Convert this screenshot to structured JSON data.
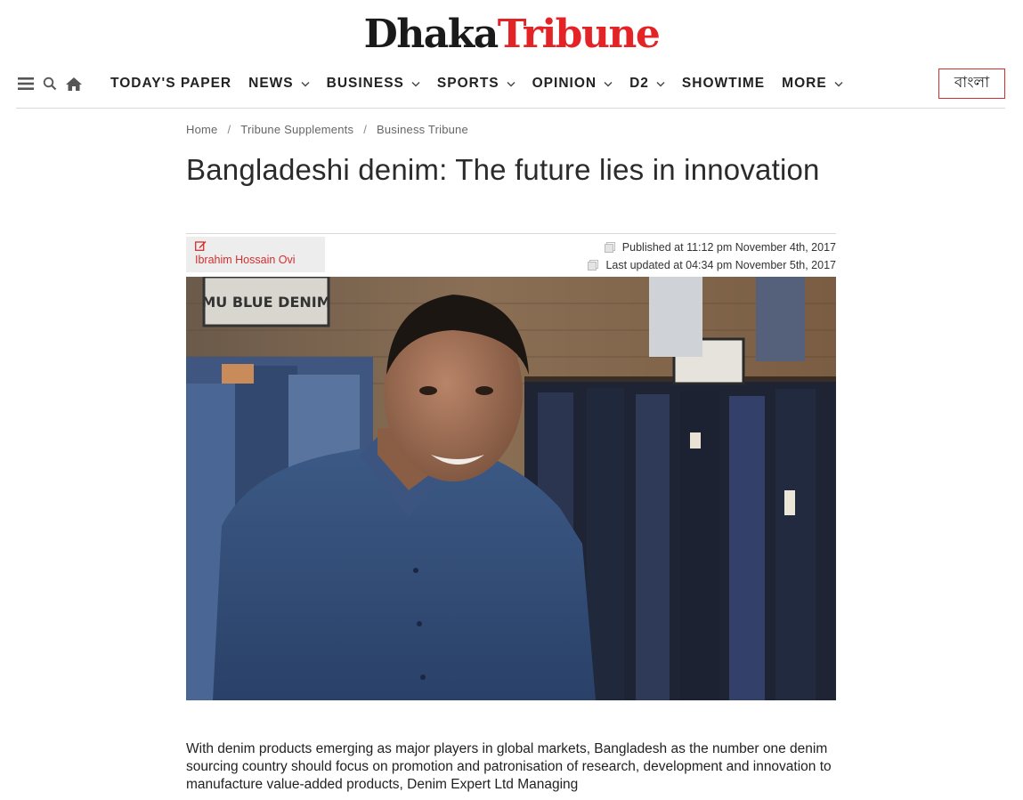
{
  "masthead": {
    "logo_part1": "Dhaka",
    "logo_part2": "Tribune"
  },
  "nav": {
    "icons": [
      "menu-icon",
      "search-icon",
      "home-icon"
    ],
    "items": [
      {
        "label": "TODAY'S PAPER",
        "has_dropdown": false
      },
      {
        "label": "NEWS",
        "has_dropdown": true
      },
      {
        "label": "BUSINESS",
        "has_dropdown": true
      },
      {
        "label": "SPORTS",
        "has_dropdown": true
      },
      {
        "label": "OPINION",
        "has_dropdown": true
      },
      {
        "label": "D2",
        "has_dropdown": true
      },
      {
        "label": "SHOWTIME",
        "has_dropdown": false
      },
      {
        "label": "MORE",
        "has_dropdown": true
      }
    ],
    "language_button": "বাংলা"
  },
  "breadcrumb": [
    "Home",
    "Tribune Supplements",
    "Business Tribune"
  ],
  "article": {
    "title": "Bangladeshi denim: The future lies in innovation",
    "author": "Ibrahim Hossain Ovi",
    "published": "Published at 11:12 pm November 4th, 2017",
    "updated": "Last updated at 04:34 pm November 5th, 2017",
    "body_text": "With denim products emerging as major players in global markets, Bangladesh as the number one denim sourcing country should focus on promotion and patronisation of research, development and innovation to manufacture value-added products, Denim Expert Ltd Managing",
    "hero_sign_text": "MU BLUE DENIM"
  },
  "colors": {
    "brand_red": "#e32326",
    "text_dark": "#222222",
    "author_red": "#d32f2f"
  }
}
